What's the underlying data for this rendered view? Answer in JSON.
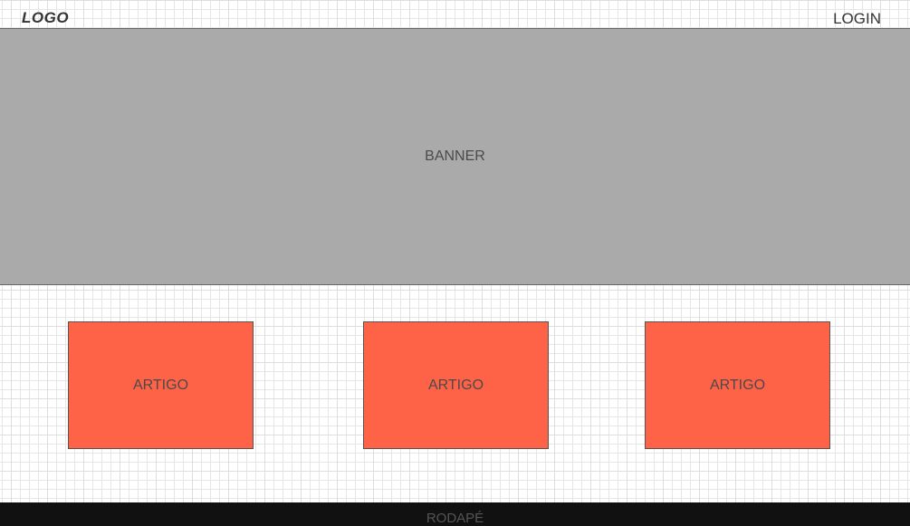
{
  "header": {
    "logo": "LOGO",
    "login": "LOGIN"
  },
  "banner": {
    "label": "BANNER"
  },
  "articles": [
    {
      "label": "ARTIGO"
    },
    {
      "label": "ARTIGO"
    },
    {
      "label": "ARTIGO"
    }
  ],
  "footer": {
    "label": "RODAPÉ"
  },
  "colors": {
    "banner": "#aaaaaa",
    "article": "#ff6347",
    "footer": "#111111",
    "text": "#333333"
  }
}
